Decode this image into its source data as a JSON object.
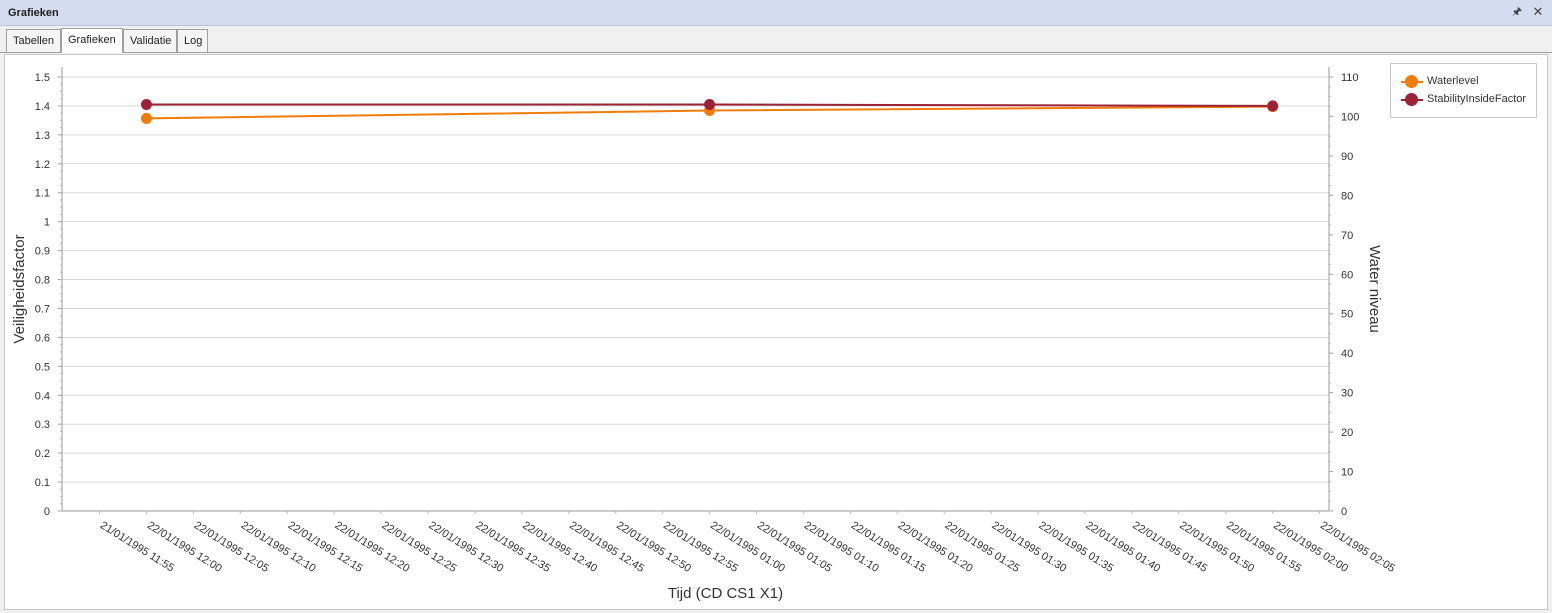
{
  "panel": {
    "title": "Grafieken",
    "pin_icon": "pin-icon",
    "close_icon": "close-icon"
  },
  "tabs": [
    {
      "label": "Tabellen",
      "active": false
    },
    {
      "label": "Grafieken",
      "active": true
    },
    {
      "label": "Validatie",
      "active": false
    },
    {
      "label": "Log",
      "active": false
    }
  ],
  "chart_data": {
    "type": "line",
    "xlabel": "Tijd (CD CS1 X1)",
    "ylabel": "Veiligheidsfactor",
    "y2label": "Water niveau",
    "ylim": [
      0,
      1.5
    ],
    "y2lim": [
      0,
      110
    ],
    "yticks": [
      "0",
      "0.1",
      "0.2",
      "0.3",
      "0.4",
      "0.5",
      "0.6",
      "0.7",
      "0.8",
      "0.9",
      "1",
      "1.1",
      "1.2",
      "1.3",
      "1.4",
      "1.5"
    ],
    "y2ticks": [
      "0",
      "10",
      "20",
      "30",
      "40",
      "50",
      "60",
      "70",
      "80",
      "90",
      "100",
      "110"
    ],
    "xticks": [
      "21/01/1995 11:55",
      "22/01/1995 12:00",
      "22/01/1995 12:05",
      "22/01/1995 12:10",
      "22/01/1995 12:15",
      "22/01/1995 12:20",
      "22/01/1995 12:25",
      "22/01/1995 12:30",
      "22/01/1995 12:35",
      "22/01/1995 12:40",
      "22/01/1995 12:45",
      "22/01/1995 12:50",
      "22/01/1995 12:55",
      "22/01/1995 01:00",
      "22/01/1995 01:05",
      "22/01/1995 01:10",
      "22/01/1995 01:15",
      "22/01/1995 01:20",
      "22/01/1995 01:25",
      "22/01/1995 01:30",
      "22/01/1995 01:35",
      "22/01/1995 01:40",
      "22/01/1995 01:45",
      "22/01/1995 01:50",
      "22/01/1995 01:55",
      "22/01/1995 02:00",
      "22/01/1995 02:05"
    ],
    "x": [
      "22/01/1995 12:00",
      "22/01/1995 01:00",
      "22/01/1995 02:00"
    ],
    "series": [
      {
        "name": "Waterlevel",
        "axis": "y2",
        "color": "#f07c0c",
        "values": [
          99.5,
          101.5,
          102.5
        ]
      },
      {
        "name": "StabilityInsideFactor",
        "axis": "y",
        "color": "#9b2335",
        "values": [
          1.405,
          1.405,
          1.4
        ]
      }
    ],
    "grid": true,
    "legend": "top-right"
  }
}
